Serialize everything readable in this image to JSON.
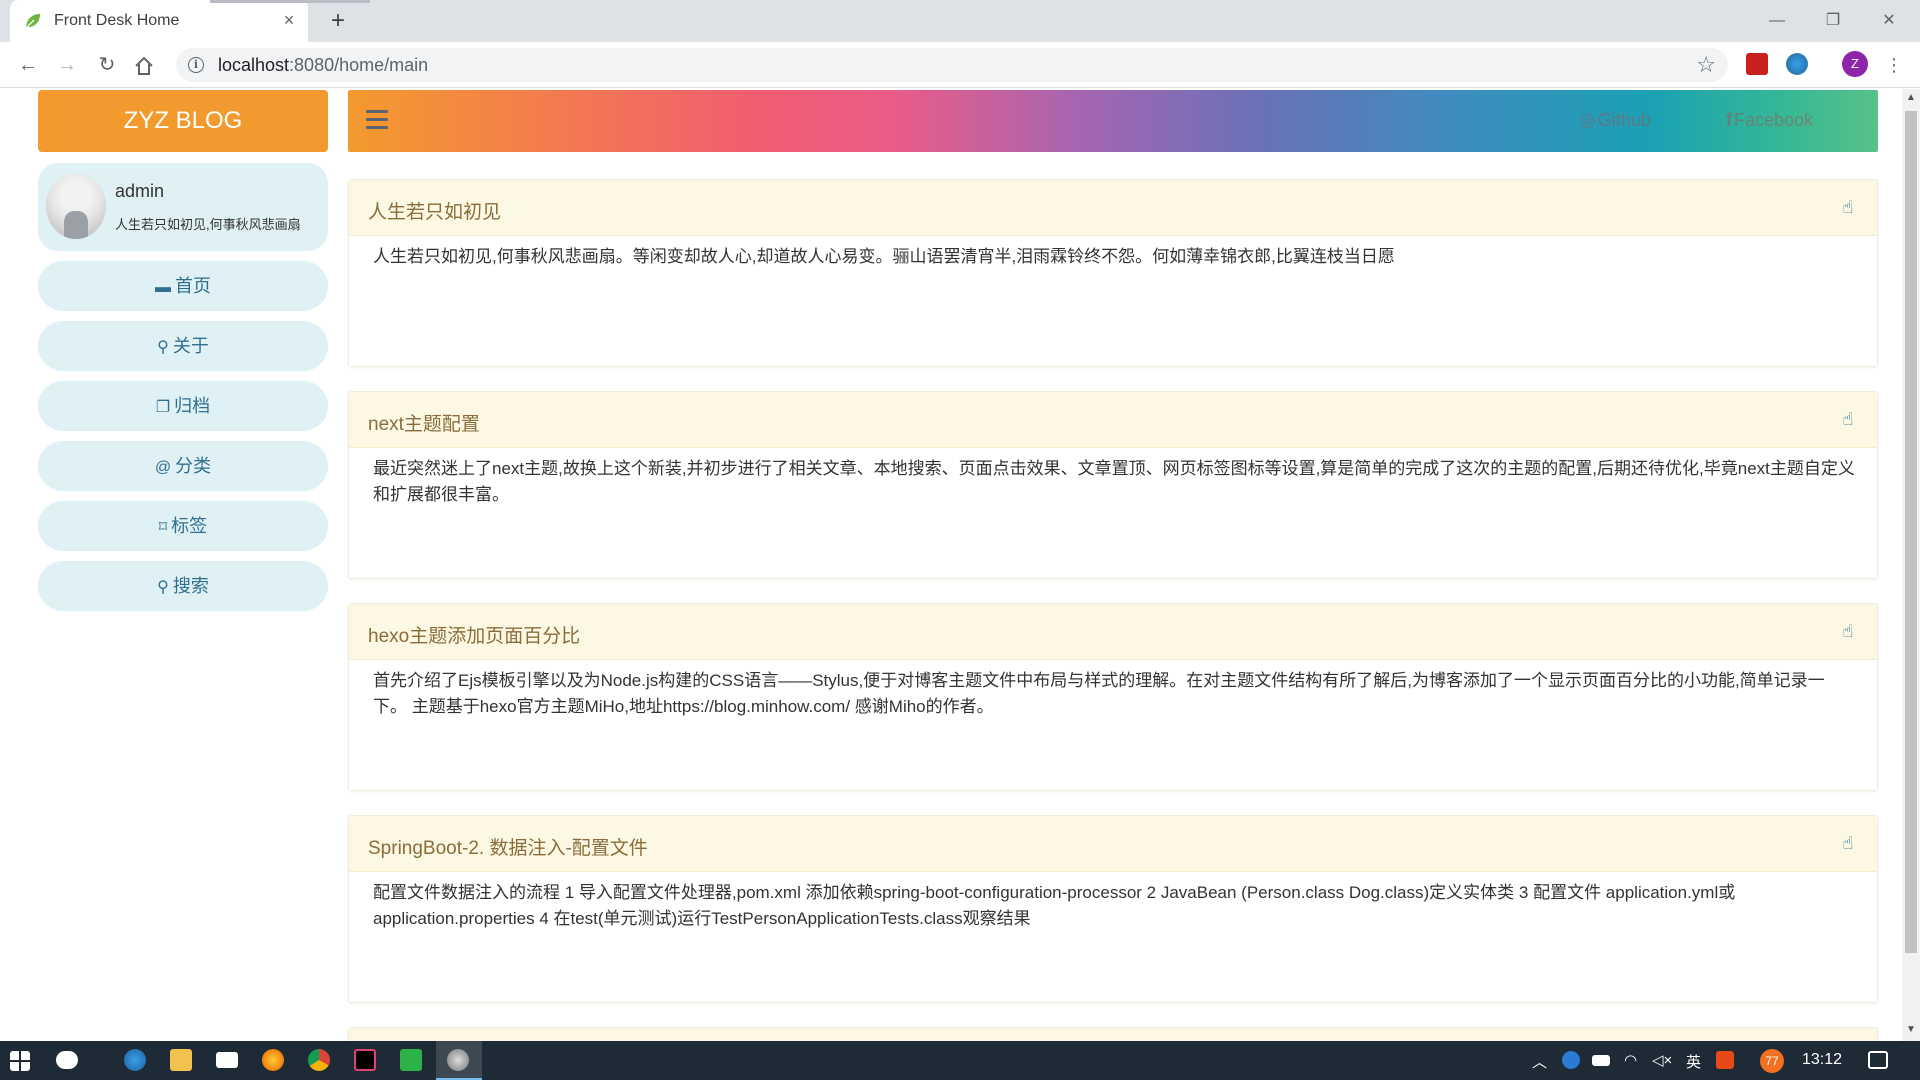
{
  "browser": {
    "tab_title": "Front Desk Home",
    "new_tab_label": "+",
    "close_label": "×",
    "url_host": "localhost",
    "url_rest": ":8080/home/main",
    "profile_initial": "Z",
    "window_controls": {
      "minimize": "—",
      "maximize": "❐",
      "close": "✕"
    }
  },
  "sidebar": {
    "brand": "ZYZ BLOG",
    "profile": {
      "name": "admin",
      "motto": "人生若只如初见,何事秋风悲画扇"
    },
    "items": [
      {
        "icon": "archive-box-icon",
        "glyph": "▬",
        "label": "首页"
      },
      {
        "icon": "user-icon",
        "glyph": "⚲",
        "label": "关于"
      },
      {
        "icon": "files-icon",
        "glyph": "❐",
        "label": "归档"
      },
      {
        "icon": "at-sign-icon",
        "glyph": "@",
        "label": "分类"
      },
      {
        "icon": "bookmark-icon",
        "glyph": "⌑",
        "label": "标签"
      },
      {
        "icon": "search-icon",
        "glyph": "⚲",
        "label": "搜索"
      }
    ]
  },
  "header": {
    "links": [
      {
        "icon": "github-icon",
        "glyph": "◎",
        "label": "Github"
      },
      {
        "icon": "facebook-icon",
        "glyph": "f",
        "label": "Facebook"
      }
    ]
  },
  "posts": [
    {
      "title": "人生若只如初见",
      "summary": "人生若只如初见,何事秋风悲画扇。等闲变却故人心,却道故人心易变。骊山语罢清宵半,泪雨霖铃终不怨。何如薄幸锦衣郎,比翼连枝当日愿"
    },
    {
      "title": "next主题配置",
      "summary": "最近突然迷上了next主题,故换上这个新装,并初步进行了相关文章、本地搜索、页面点击效果、文章置顶、网页标签图标等设置,算是简单的完成了这次的主题的配置,后期还待优化,毕竟next主题自定义和扩展都很丰富。"
    },
    {
      "title": "hexo主题添加页面百分比",
      "summary": "首先介绍了Ejs模板引擎以及为Node.js构建的CSS语言——Stylus,便于对博客主题文件中布局与样式的理解。在对主题文件结构有所了解后,为博客添加了一个显示页面百分比的小功能,简单记录一下。 主题基于hexo官方主题MiHo,地址https://blog.minhow.com/ 感谢Miho的作者。"
    },
    {
      "title": "SpringBoot-2. 数据注入-配置文件",
      "summary": "配置文件数据注入的流程 1 导入配置文件处理器,pom.xml 添加依赖spring-boot-configuration-processor 2 JavaBean (Person.class Dog.class)定义实体类 3 配置文件 application.yml或application.properties 4 在test(单元测试)运行TestPersonApplicationTests.class观察结果"
    }
  ],
  "taskbar": {
    "time": "13:12",
    "ime": "英",
    "badge": "77"
  },
  "colors": {
    "brand_orange": "#f39a2e",
    "sidebar_item_bg": "#dff1f5",
    "sidebar_item_text": "#31708f",
    "post_header_bg": "#fcf8e3",
    "post_title": "#8a6d3b"
  }
}
